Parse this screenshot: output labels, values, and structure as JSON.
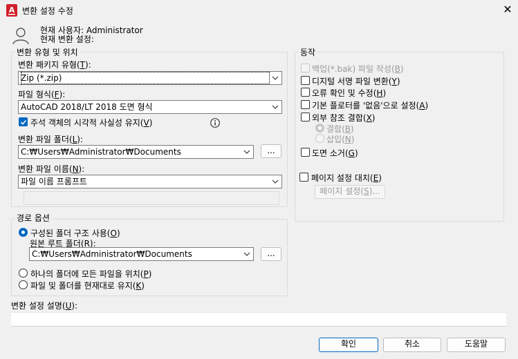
{
  "window": {
    "title": "변환 설정 수정",
    "app_icon_letter": "A",
    "app_icon_color": "#d0202a"
  },
  "user": {
    "line1": "현재 사용자: Administrator",
    "line2": "현재 변환 설정:"
  },
  "transmittal": {
    "group_label": "변환 유형 및 위치",
    "package_type_label": "변환 패키지 유형(",
    "package_type_key": "T",
    "package_type_value": "Zip (*.zip)",
    "file_format_label": "파일 형식(",
    "file_format_key": "F",
    "file_format_value": "AutoCAD 2018/LT 2018 도면 형식",
    "maintain_visual_label": "주석 객체의 시각적 사실성 유지(",
    "maintain_visual_key": "V",
    "maintain_visual_checked": true,
    "folder_label": "변환 파일 폴더(",
    "folder_key": "L",
    "folder_value": "C:₩Users₩Administrator₩Documents",
    "browse_label": "...",
    "filename_label": "변환 파일 이름(",
    "filename_key": "N",
    "filename_value": "파일 이름 프롬프트"
  },
  "path_options": {
    "group_label": "경로 옵션",
    "organized_label": "구성된 폴더 구조 사용(",
    "organized_key": "O",
    "source_root_label": "원본 루트 폴더(",
    "source_root_key": "R",
    "source_root_value": "C:₩Users₩Administrator₩Documents",
    "browse_label": "...",
    "single_folder_label": "하나의 폴더에 모든 파일을 위치(",
    "single_folder_key": "P",
    "keep_as_is_label": "파일 및 폴더를 현재대로 유지(",
    "keep_as_is_key": "K",
    "selected": "organized"
  },
  "actions": {
    "group_label": "동작",
    "backup_label": "백업(*.bak) 파일 작성(",
    "backup_key": "B",
    "digital_sign_label": "디지털 서명 파일 변환(",
    "digital_sign_key": "Y",
    "audit_label": "오류 확인 및 수정(",
    "audit_key": "H",
    "plotter_label": "기본 플로터를 '없음'으로 설정(",
    "plotter_key": "A",
    "bind_xref_label": "외부 참조 결합(",
    "bind_xref_key": "X",
    "bind_label": "결합(",
    "bind_key": "B",
    "insert_label": "삽입(",
    "insert_key": "N",
    "purge_label": "도면 소거(",
    "purge_key": "G",
    "page_setup_replace_label": "페이지 설정 대치(",
    "page_setup_replace_key": "E",
    "page_setup_button_label": "페이지 설정(",
    "page_setup_button_key": "S",
    "page_setup_button_suffix": ")..."
  },
  "description": {
    "label": "변환 설정 설명(",
    "key": "U",
    "value": ""
  },
  "buttons": {
    "ok": "확인",
    "cancel": "취소",
    "help": "도움말"
  },
  "colors": {
    "accent": "#0067c0",
    "window_bg": "#f0f0f0",
    "disabled_text": "#9a9a9a"
  }
}
